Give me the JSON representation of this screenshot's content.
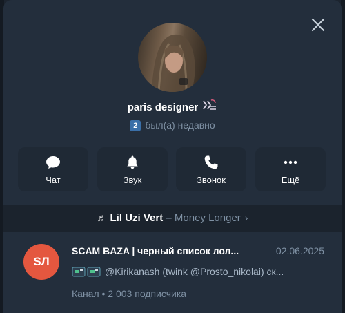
{
  "profile": {
    "name": "paris designer",
    "status_badge": "2",
    "status_text": "был(а) недавно"
  },
  "actions": [
    {
      "label": "Чат",
      "icon": "chat-bubble-icon"
    },
    {
      "label": "Звук",
      "icon": "bell-icon"
    },
    {
      "label": "Звонок",
      "icon": "phone-icon"
    },
    {
      "label": "Ещё",
      "icon": "more-dots-icon"
    }
  ],
  "music": {
    "note": "♬",
    "artist": "Lil Uzi Vert",
    "separator": " – ",
    "title": "Money Longer",
    "chevron": "›"
  },
  "channel": {
    "avatar_initials": "SЛ",
    "title": "SCAM BAZA | черный список лол...",
    "date": "02.06.2025",
    "subtitle": "@Kirikanash (twink @Prosto_nikolai)   ск...",
    "meta": "Канал • 2 003 подписчика"
  },
  "colors": {
    "panel_bg": "#232e3c",
    "button_bg": "#1f2935",
    "muted_text": "#7f91a4",
    "badge_blue": "#3a6fa8",
    "channel_avatar": "#e4573f"
  }
}
